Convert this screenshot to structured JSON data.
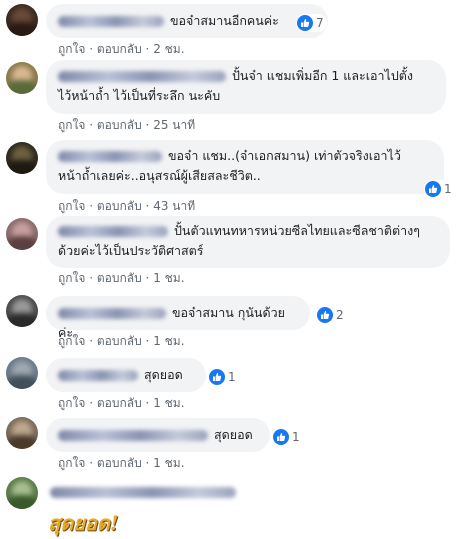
{
  "comments": [
    {
      "text": "ขอจ๋าสมานอีกคนค่ะ",
      "reactions": "7",
      "actions": [
        "ถูกใจ",
        "ตอบกลับ",
        "2 ชม."
      ]
    },
    {
      "text_line1": "ปั้นจ๋า แชมเพิ่มอีก 1 และเอาไปตั้ง",
      "text_line2": "ไว้หน้าถ้ำ ไว้เป็นที่ระลึก นะคับ",
      "actions": [
        "ถูกใจ",
        "ตอบกลับ",
        "25 นาที"
      ]
    },
    {
      "text_line1": "ขอจ๋า แชม..(จ๋าเอกสมาน) เท่าตัวจริงเอาไว้",
      "text_line2": "หน้าถ้ำเลยค่ะ..อนุสรณ์ผู้เสียสละชีวิต..",
      "reactions": "1",
      "actions": [
        "ถูกใจ",
        "ตอบกลับ",
        "43 นาที"
      ]
    },
    {
      "text_line1": "ปั้นตัวแทนทหารหน่วยซีลไทยและซีลชาติต่างๆ",
      "text_line2": "ด้วยค่ะไว้เป็นประวัติศาสตร์",
      "actions": [
        "ถูกใจ",
        "ตอบกลับ",
        "1 ชม."
      ]
    },
    {
      "text": "ขอจ๋าสมาน กุนันด้วยค่ะ",
      "reactions": "2",
      "actions": [
        "ถูกใจ",
        "ตอบกลับ",
        "1 ชม."
      ]
    },
    {
      "text": "สุดยอด",
      "reactions": "1",
      "actions": [
        "ถูกใจ",
        "ตอบกลับ",
        "1 ชม."
      ]
    },
    {
      "text": "สุดยอด",
      "reactions": "1",
      "actions": [
        "ถูกใจ",
        "ตอบกลับ",
        "1 ชม."
      ]
    },
    {
      "sticker_text": "สุดยอด!"
    }
  ],
  "separator": " · ",
  "colors": {
    "bubble": "#f2f3f5",
    "like": "#1877f2",
    "meta": "#606770",
    "sticker": "#e8a92c"
  }
}
